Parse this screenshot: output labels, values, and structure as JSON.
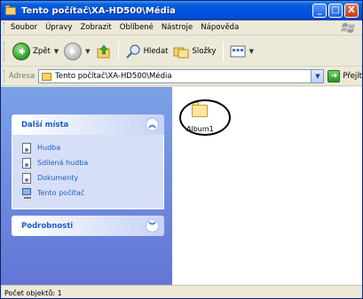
{
  "window": {
    "title": "Tento počítač\\XA-HD500\\Média",
    "minimize": "_",
    "maximize": "□",
    "close": "X"
  },
  "menubar": {
    "items": [
      "Soubor",
      "Úpravy",
      "Zobrazit",
      "Oblíbené",
      "Nástroje",
      "Nápověda"
    ]
  },
  "toolbar": {
    "back_label": "Zpět",
    "search_label": "Hledat",
    "folders_label": "Složky"
  },
  "address": {
    "label": "Adresa",
    "value": "Tento počítač\\XA-HD500\\Média",
    "go_label": "Přejít"
  },
  "sidebar": {
    "other_places": {
      "title": "Další místa",
      "items": [
        "Hudba",
        "Sdílená hudba",
        "Dokumenty",
        "Tento počítač"
      ]
    },
    "details": {
      "title": "Podrobnosti"
    }
  },
  "content": {
    "items": [
      {
        "name": "Album1",
        "icon": "folder-icon"
      }
    ]
  },
  "status": {
    "text": "Počet objektů: 1"
  }
}
